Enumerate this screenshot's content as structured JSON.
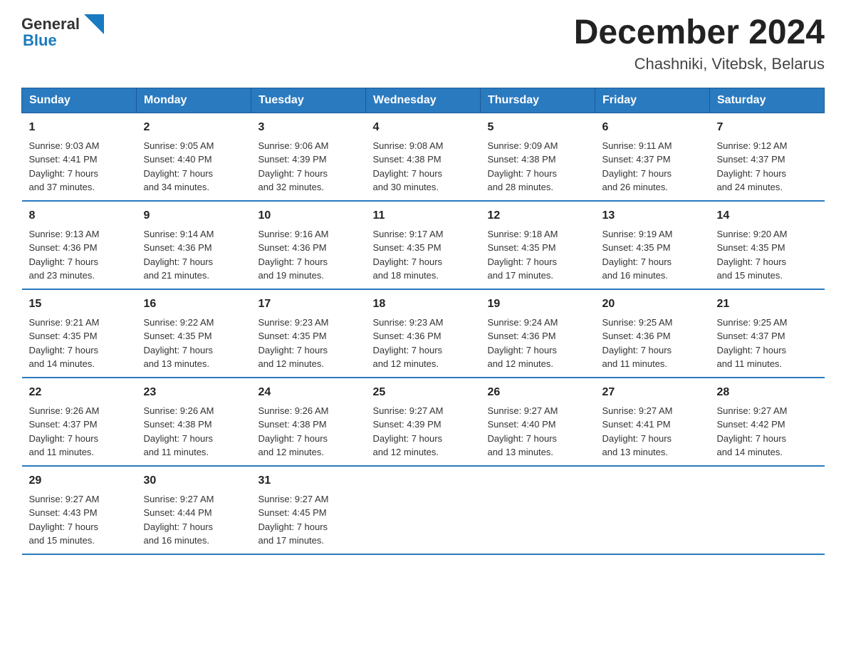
{
  "logo": {
    "text_general": "General",
    "text_blue": "Blue",
    "alt": "GeneralBlue logo"
  },
  "title": {
    "month_year": "December 2024",
    "location": "Chashniki, Vitebsk, Belarus"
  },
  "headers": [
    "Sunday",
    "Monday",
    "Tuesday",
    "Wednesday",
    "Thursday",
    "Friday",
    "Saturday"
  ],
  "weeks": [
    [
      {
        "day": "1",
        "info": "Sunrise: 9:03 AM\nSunset: 4:41 PM\nDaylight: 7 hours\nand 37 minutes."
      },
      {
        "day": "2",
        "info": "Sunrise: 9:05 AM\nSunset: 4:40 PM\nDaylight: 7 hours\nand 34 minutes."
      },
      {
        "day": "3",
        "info": "Sunrise: 9:06 AM\nSunset: 4:39 PM\nDaylight: 7 hours\nand 32 minutes."
      },
      {
        "day": "4",
        "info": "Sunrise: 9:08 AM\nSunset: 4:38 PM\nDaylight: 7 hours\nand 30 minutes."
      },
      {
        "day": "5",
        "info": "Sunrise: 9:09 AM\nSunset: 4:38 PM\nDaylight: 7 hours\nand 28 minutes."
      },
      {
        "day": "6",
        "info": "Sunrise: 9:11 AM\nSunset: 4:37 PM\nDaylight: 7 hours\nand 26 minutes."
      },
      {
        "day": "7",
        "info": "Sunrise: 9:12 AM\nSunset: 4:37 PM\nDaylight: 7 hours\nand 24 minutes."
      }
    ],
    [
      {
        "day": "8",
        "info": "Sunrise: 9:13 AM\nSunset: 4:36 PM\nDaylight: 7 hours\nand 23 minutes."
      },
      {
        "day": "9",
        "info": "Sunrise: 9:14 AM\nSunset: 4:36 PM\nDaylight: 7 hours\nand 21 minutes."
      },
      {
        "day": "10",
        "info": "Sunrise: 9:16 AM\nSunset: 4:36 PM\nDaylight: 7 hours\nand 19 minutes."
      },
      {
        "day": "11",
        "info": "Sunrise: 9:17 AM\nSunset: 4:35 PM\nDaylight: 7 hours\nand 18 minutes."
      },
      {
        "day": "12",
        "info": "Sunrise: 9:18 AM\nSunset: 4:35 PM\nDaylight: 7 hours\nand 17 minutes."
      },
      {
        "day": "13",
        "info": "Sunrise: 9:19 AM\nSunset: 4:35 PM\nDaylight: 7 hours\nand 16 minutes."
      },
      {
        "day": "14",
        "info": "Sunrise: 9:20 AM\nSunset: 4:35 PM\nDaylight: 7 hours\nand 15 minutes."
      }
    ],
    [
      {
        "day": "15",
        "info": "Sunrise: 9:21 AM\nSunset: 4:35 PM\nDaylight: 7 hours\nand 14 minutes."
      },
      {
        "day": "16",
        "info": "Sunrise: 9:22 AM\nSunset: 4:35 PM\nDaylight: 7 hours\nand 13 minutes."
      },
      {
        "day": "17",
        "info": "Sunrise: 9:23 AM\nSunset: 4:35 PM\nDaylight: 7 hours\nand 12 minutes."
      },
      {
        "day": "18",
        "info": "Sunrise: 9:23 AM\nSunset: 4:36 PM\nDaylight: 7 hours\nand 12 minutes."
      },
      {
        "day": "19",
        "info": "Sunrise: 9:24 AM\nSunset: 4:36 PM\nDaylight: 7 hours\nand 12 minutes."
      },
      {
        "day": "20",
        "info": "Sunrise: 9:25 AM\nSunset: 4:36 PM\nDaylight: 7 hours\nand 11 minutes."
      },
      {
        "day": "21",
        "info": "Sunrise: 9:25 AM\nSunset: 4:37 PM\nDaylight: 7 hours\nand 11 minutes."
      }
    ],
    [
      {
        "day": "22",
        "info": "Sunrise: 9:26 AM\nSunset: 4:37 PM\nDaylight: 7 hours\nand 11 minutes."
      },
      {
        "day": "23",
        "info": "Sunrise: 9:26 AM\nSunset: 4:38 PM\nDaylight: 7 hours\nand 11 minutes."
      },
      {
        "day": "24",
        "info": "Sunrise: 9:26 AM\nSunset: 4:38 PM\nDaylight: 7 hours\nand 12 minutes."
      },
      {
        "day": "25",
        "info": "Sunrise: 9:27 AM\nSunset: 4:39 PM\nDaylight: 7 hours\nand 12 minutes."
      },
      {
        "day": "26",
        "info": "Sunrise: 9:27 AM\nSunset: 4:40 PM\nDaylight: 7 hours\nand 13 minutes."
      },
      {
        "day": "27",
        "info": "Sunrise: 9:27 AM\nSunset: 4:41 PM\nDaylight: 7 hours\nand 13 minutes."
      },
      {
        "day": "28",
        "info": "Sunrise: 9:27 AM\nSunset: 4:42 PM\nDaylight: 7 hours\nand 14 minutes."
      }
    ],
    [
      {
        "day": "29",
        "info": "Sunrise: 9:27 AM\nSunset: 4:43 PM\nDaylight: 7 hours\nand 15 minutes."
      },
      {
        "day": "30",
        "info": "Sunrise: 9:27 AM\nSunset: 4:44 PM\nDaylight: 7 hours\nand 16 minutes."
      },
      {
        "day": "31",
        "info": "Sunrise: 9:27 AM\nSunset: 4:45 PM\nDaylight: 7 hours\nand 17 minutes."
      },
      {
        "day": "",
        "info": ""
      },
      {
        "day": "",
        "info": ""
      },
      {
        "day": "",
        "info": ""
      },
      {
        "day": "",
        "info": ""
      }
    ]
  ]
}
